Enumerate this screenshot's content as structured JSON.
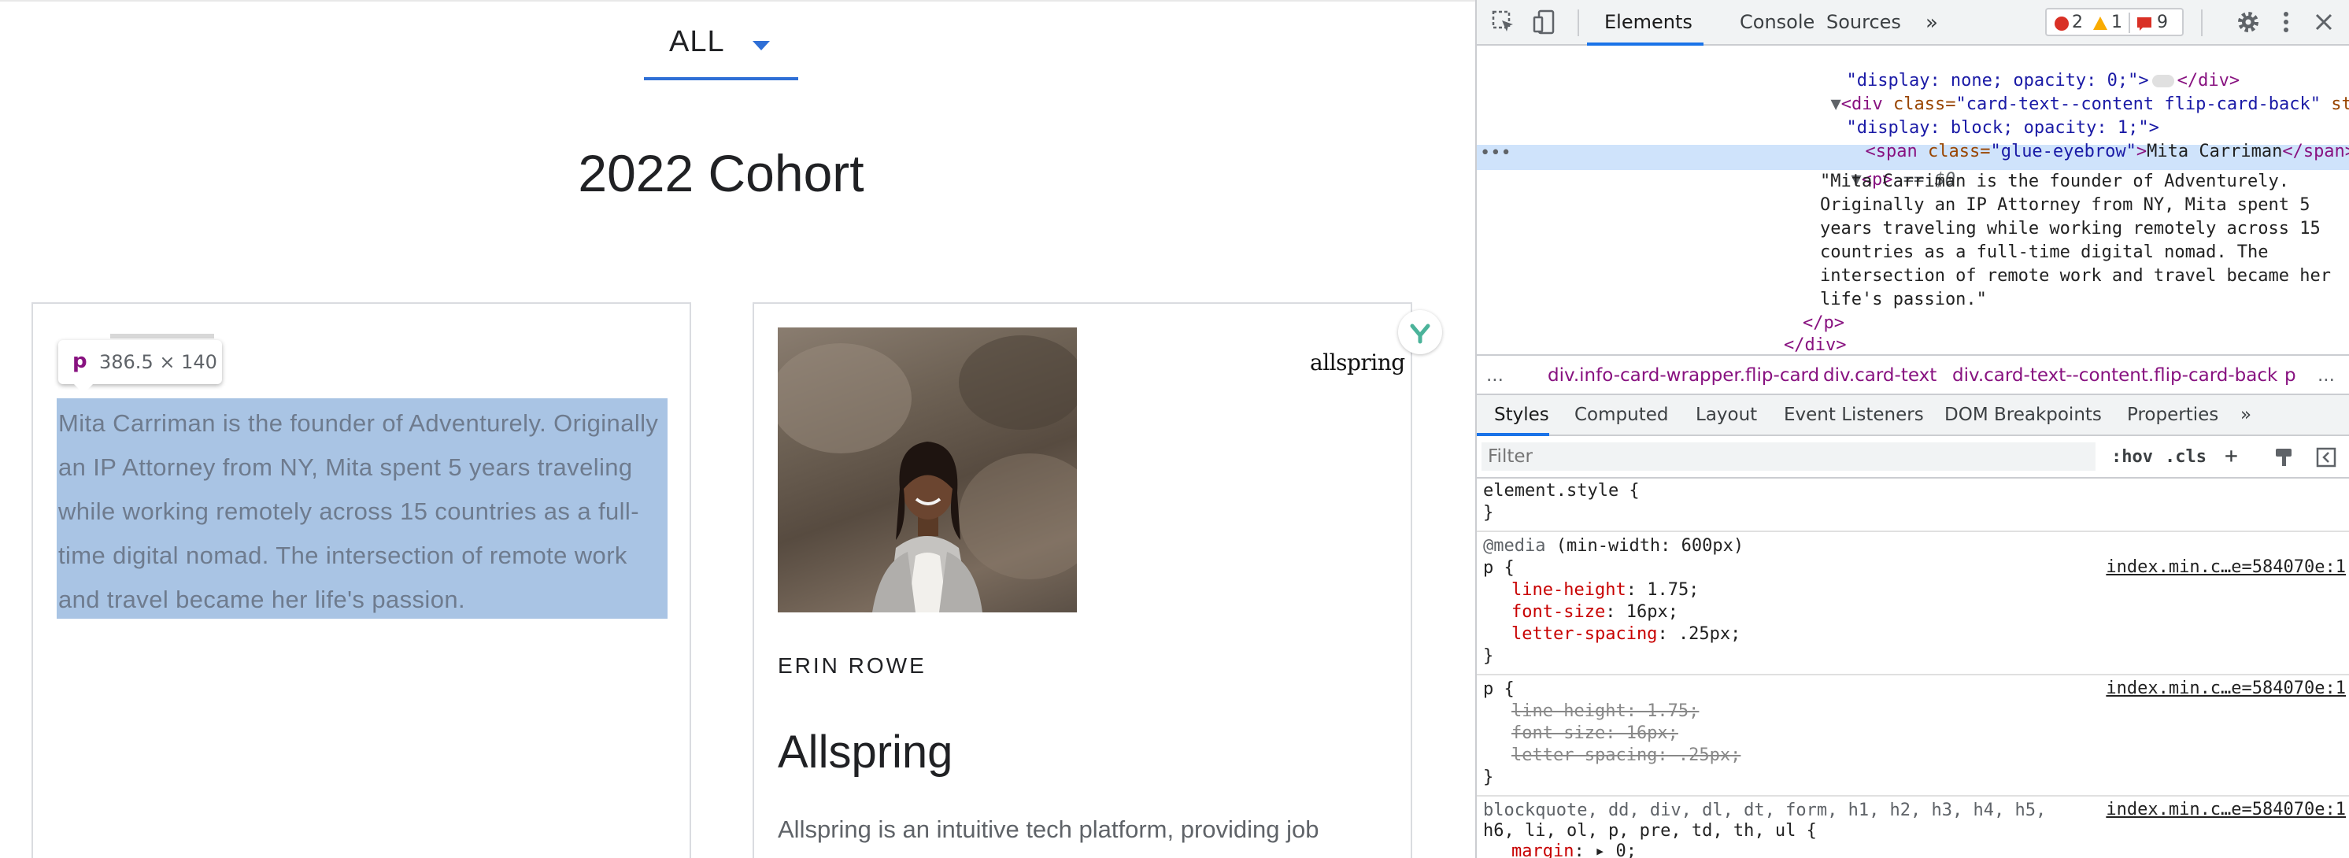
{
  "page": {
    "filter": {
      "label": "ALL"
    },
    "cohort_title": "2022 Cohort",
    "left_card": {
      "bio": "Mita Carriman is the founder of Adventurely. Originally an IP Attorney from NY, Mita spent 5 years traveling while working remotely across 15 countries as a full-time digital nomad. The intersection of remote work and travel became her life's passion.",
      "tooltip": {
        "tag": "p",
        "size": "386.5 × 140"
      }
    },
    "right_card": {
      "brand": "allspring",
      "person_name": "ERIN ROWE",
      "company": "Allspring",
      "description": "Allspring is an intuitive tech platform, providing job"
    }
  },
  "devtools": {
    "tabs": {
      "elements": "Elements",
      "console": "Console",
      "sources": "Sources",
      "more": "»"
    },
    "counters": {
      "errors": "2",
      "warnings": "1",
      "issues": "9"
    },
    "dom": {
      "line1": "\"display: none; opacity: 0;\">",
      "line1_end": "</div>",
      "line2_tag": "<div ",
      "line2_attr": "class=",
      "line2_val": "\"card-text--content flip-card-back\"",
      "line2_attr2": " style=",
      "line3": "\"display: block; opacity: 1;\">",
      "line4_open": "<span ",
      "line4_attr": "class=",
      "line4_val": "\"glue-eyebrow\"",
      "line4_text": "Mita Carriman",
      "line4_close": "</span>",
      "line5_tag": "<p>",
      "line5_sel": " == $0",
      "text_lines": [
        "\"Mita Carriman is the founder of Adventurely.",
        "Originally an IP Attorney from NY, Mita spent 5",
        "years traveling while working remotely across 15",
        "countries as a full-time digital nomad. The",
        "intersection of remote work and travel became her",
        "life's passion.\""
      ],
      "close_p": "</p>",
      "close_div": "</div>"
    },
    "breadcrumbs": [
      "...",
      "div.info-card-wrapper.flip-card",
      "div.card-text",
      "div.card-text--content.flip-card-back",
      "p",
      "..."
    ],
    "styles_tabs": [
      "Styles",
      "Computed",
      "Layout",
      "Event Listeners",
      "DOM Breakpoints",
      "Properties",
      "»"
    ],
    "filter": {
      "placeholder": "Filter",
      "hov": ":hov",
      "cls": ".cls"
    },
    "rules": {
      "element_style": "element.style {",
      "close": "}",
      "media": "@media",
      "media_query": " (min-width: 600px)",
      "p_selector": "p {",
      "source": "index.min.c…e=584070e:1",
      "props": [
        {
          "name": "line-height",
          "value": "1.75;"
        },
        {
          "name": "font-size",
          "value": "16px;"
        },
        {
          "name": "letter-spacing",
          "value": ".25px;"
        }
      ],
      "struck": [
        "line-height: 1.75;",
        "font-size: 16px;",
        "letter-spacing: .25px;"
      ],
      "reset_selector_1": "blockquote, dd, div, dl, dt, form, h1, h2, h3, h4, h5,",
      "reset_selector_2": "h6, li, ol, p, pre, td, th, ul {",
      "margin_prop": "margin",
      "margin_val": ": ▸ 0;"
    }
  }
}
